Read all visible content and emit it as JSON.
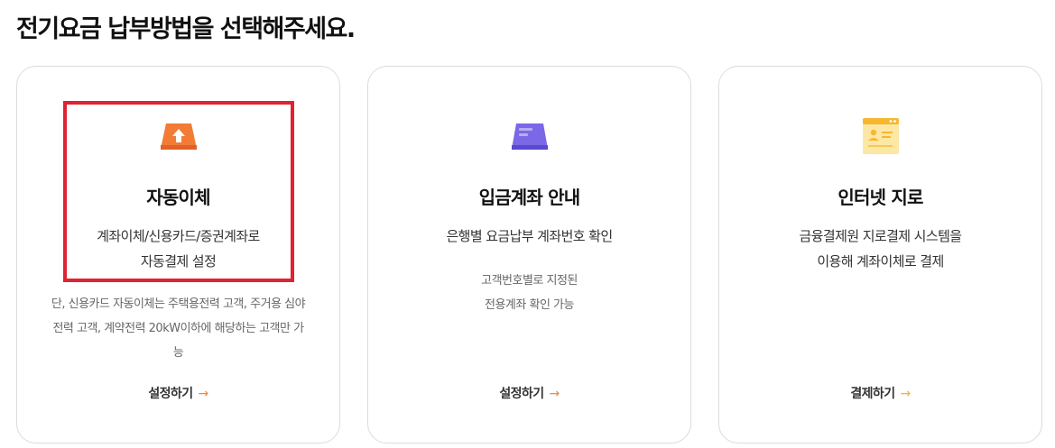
{
  "page_title": "전기요금 납부방법을 선택해주세요.",
  "cards": [
    {
      "icon": "upload-card-icon",
      "title": "자동이체",
      "desc": [
        "계좌이체/신용카드/증권계좌로",
        "자동결제 설정"
      ],
      "note": [
        "단, 신용카드 자동이체는 주택용전력 고객, 주거용 심야",
        "전력 고객, 계약전력 20kW이하에 해당하는 고객만 가",
        "능"
      ],
      "action": "설정하기",
      "accent": "#f27b35"
    },
    {
      "icon": "bank-card-icon",
      "title": "입금계좌 안내",
      "desc": [
        "은행별 요금납부 계좌번호 확인"
      ],
      "note": [
        "고객번호별로 지정된",
        "전용계좌 확인 가능"
      ],
      "action": "설정하기",
      "accent": "#6c5ce7"
    },
    {
      "icon": "internet-window-icon",
      "title": "인터넷 지로",
      "desc": [
        "금융결제원 지로결제 시스템을",
        "이용해 계좌이체로 결제"
      ],
      "note": [],
      "action": "결제하기",
      "accent": "#f5b82e"
    }
  ],
  "arrow_glyph": "→",
  "highlight_color": "#e02232"
}
